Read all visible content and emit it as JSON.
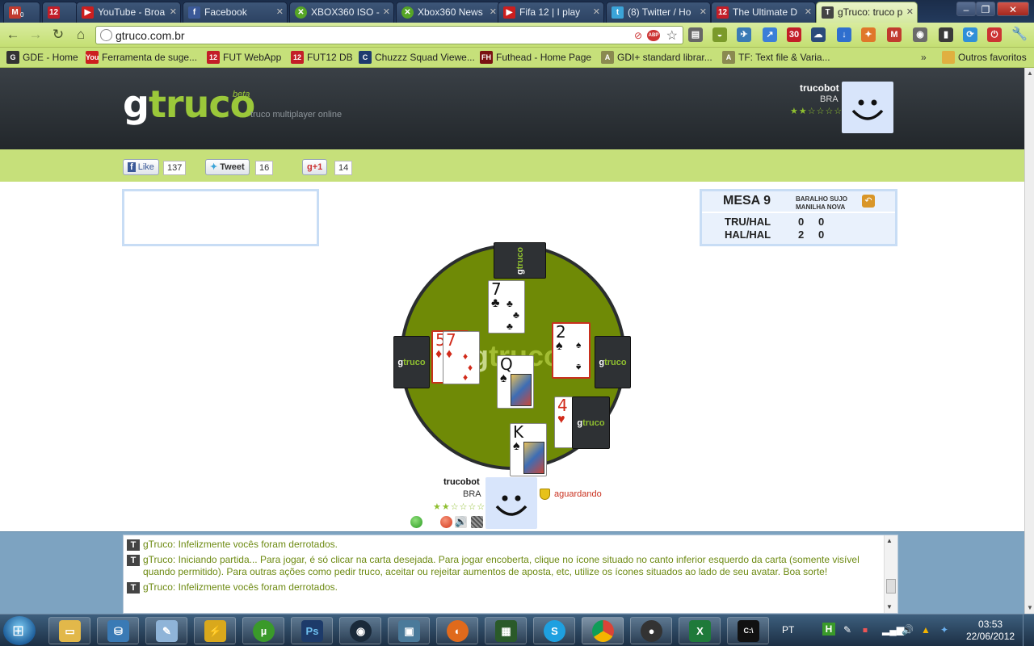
{
  "browser": {
    "tabs": [
      {
        "label": "",
        "icon": "gmail",
        "color": "#c13a2e"
      },
      {
        "label": "",
        "icon": "12",
        "color": "#c31e28"
      },
      {
        "label": "YouTube - Broa",
        "icon": "youtube",
        "color": "#cc1f1f"
      },
      {
        "label": "Facebook",
        "icon": "facebook",
        "color": "#3b5998"
      },
      {
        "label": "XBOX360 ISO -",
        "icon": "xbox",
        "color": "#56a526"
      },
      {
        "label": "Xbox360 News",
        "icon": "xbox",
        "color": "#56a526"
      },
      {
        "label": "Fifa 12 | I play",
        "icon": "youtube",
        "color": "#cc1f1f"
      },
      {
        "label": "(8) Twitter / Ho",
        "icon": "twitter",
        "color": "#3ba4d8"
      },
      {
        "label": "The Ultimate D",
        "icon": "12",
        "color": "#c31e28"
      },
      {
        "label": "gTruco: truco p",
        "icon": "T",
        "color": "#444"
      }
    ],
    "gmail_count": "0",
    "url": "gtruco.com.br",
    "bookmarks": [
      {
        "label": "GDE - Home",
        "icon": "G",
        "color": "#333"
      },
      {
        "label": "Ferramenta de suge...",
        "icon": "You",
        "color": "#cc1f1f"
      },
      {
        "label": "FUT WebApp",
        "icon": "12",
        "color": "#c31e28"
      },
      {
        "label": "FUT12 DB",
        "icon": "12",
        "color": "#c31e28"
      },
      {
        "label": "Chuzzz Squad Viewe...",
        "icon": "C",
        "color": "#1e3a6e"
      },
      {
        "label": "Futhead - Home Page",
        "icon": "FH",
        "color": "#7a1212"
      },
      {
        "label": "GDI+ standard librar...",
        "icon": "A",
        "color": "#8a8a50"
      },
      {
        "label": "TF: Text file & Varia...",
        "icon": "A",
        "color": "#8a8a50"
      }
    ],
    "other_bookmarks": "Outros favoritos"
  },
  "site": {
    "logo_g": "g",
    "logo_rest": "truco",
    "beta": "beta",
    "tagline": "truco multiplayer online",
    "user": {
      "name": "trucobot",
      "country": "BRA",
      "stars": "★★☆☆☆☆"
    },
    "social": {
      "like_label": "Like",
      "like_count": "137",
      "tweet_label": "Tweet",
      "tweet_count": "16",
      "plus_label": "+1",
      "plus_count": "14"
    }
  },
  "mesa": {
    "title": "MESA 9",
    "rule1": "BARALHO SUJO",
    "rule2": "MANILHA NOVA",
    "rows": [
      {
        "team": "TRU/HAL",
        "a": "0",
        "b": "0"
      },
      {
        "team": "HAL/HAL",
        "a": "2",
        "b": "0"
      }
    ]
  },
  "table": {
    "logo": "gtruco",
    "back_logo_g": "g",
    "back_logo_rest": "truco",
    "cards": {
      "top": {
        "rank": "7",
        "suit": "♣",
        "color": "black"
      },
      "left_under": {
        "rank": "5",
        "suit": "♦",
        "color": "red"
      },
      "left": {
        "rank": "7",
        "suit": "♦",
        "color": "red"
      },
      "right": {
        "rank": "2",
        "suit": "♠",
        "color": "black"
      },
      "center": {
        "rank": "Q",
        "suit": "♠",
        "color": "black"
      },
      "hand_1": {
        "rank": "4",
        "suit": "♥",
        "color": "red"
      },
      "hand_2": {
        "rank": "K",
        "suit": "♠",
        "color": "black"
      }
    }
  },
  "player": {
    "name": "trucobot",
    "country": "BRA",
    "stars": "★★☆☆☆☆",
    "status": "aguardando"
  },
  "chat": {
    "messages": [
      "gTruco: Infelizmente vocês foram derrotados.",
      "gTruco: Iniciando partida... Para jogar, é só clicar na carta desejada. Para jogar encoberta, clique no ícone situado no canto inferior esquerdo da carta (somente visível quando permitido). Para outras ações como pedir truco, aceitar ou rejeitar aumentos de aposta, etc, utilize os ícones situados ao lado de seu avatar. Boa sorte!",
      "gTruco: Infelizmente vocês foram derrotados."
    ]
  },
  "taskbar": {
    "apps": [
      "explorer",
      "network",
      "notes",
      "winamp",
      "utorrent",
      "photoshop",
      "media-center",
      "image-viewer",
      "firefox",
      "task-manager",
      "skype",
      "chrome",
      "camera",
      "excel",
      "cmd"
    ],
    "lang": "PT",
    "time": "03:53",
    "date": "22/06/2012"
  }
}
